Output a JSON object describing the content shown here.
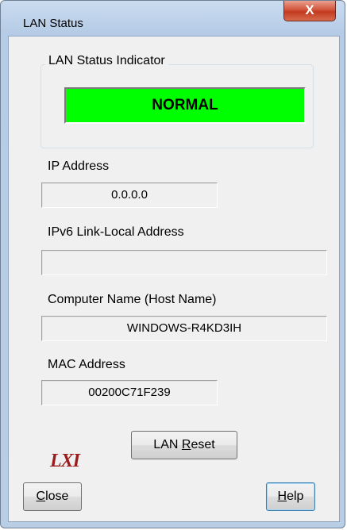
{
  "window": {
    "title": "LAN Status",
    "close_glyph": "X"
  },
  "indicator": {
    "group_label": "LAN Status Indicator",
    "status": "NORMAL",
    "status_color": "#00ff00"
  },
  "fields": {
    "ip": {
      "label": "IP Address",
      "value": "0.0.0.0"
    },
    "ipv6": {
      "label": "IPv6 Link-Local Address",
      "value": ""
    },
    "host": {
      "label": "Computer Name (Host Name)",
      "value": "WINDOWS-R4KD3IH"
    },
    "mac": {
      "label": "MAC Address",
      "value": "00200C71F239"
    }
  },
  "logo": {
    "text": "LXI"
  },
  "buttons": {
    "lan_reset": {
      "prefix": "LAN ",
      "mnemonic": "R",
      "rest": "eset"
    },
    "close": {
      "mnemonic": "C",
      "rest": "lose"
    },
    "help": {
      "mnemonic": "H",
      "rest": "elp"
    }
  }
}
